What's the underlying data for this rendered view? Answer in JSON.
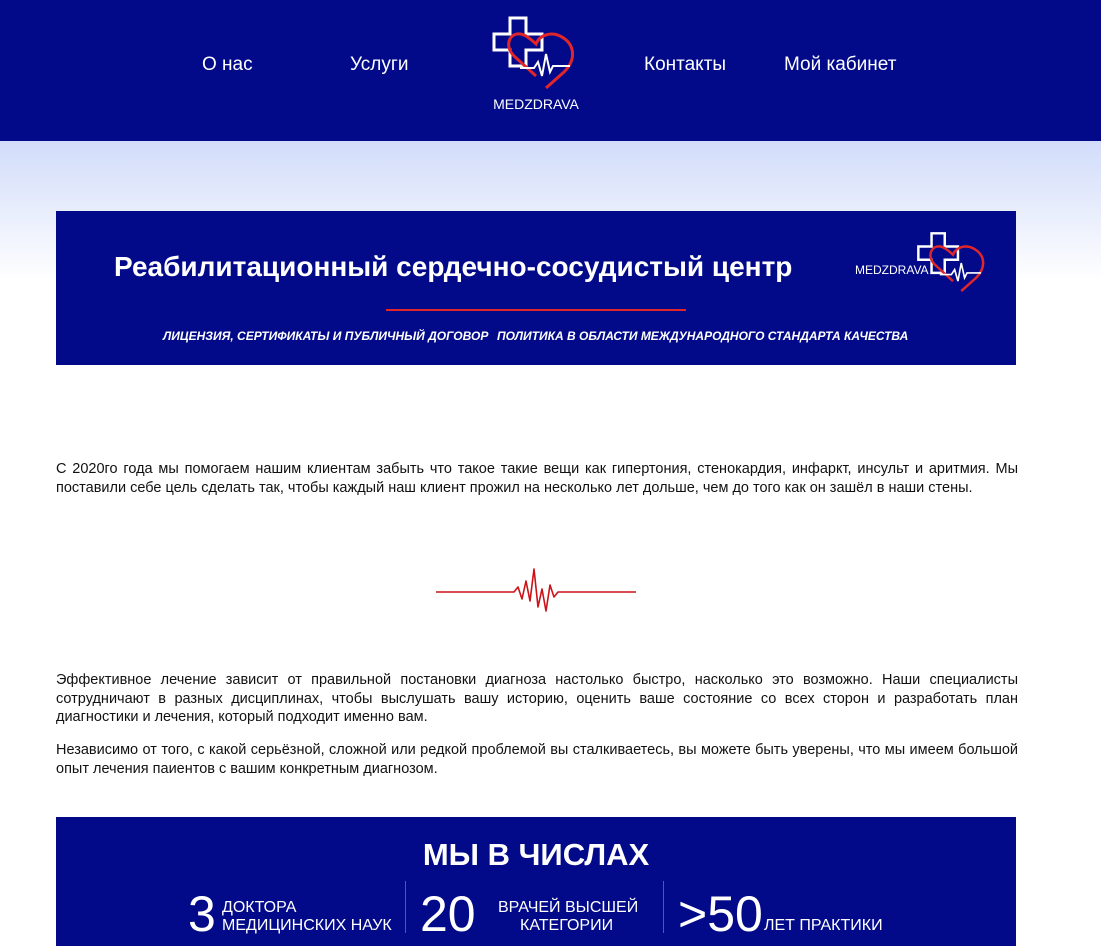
{
  "header": {
    "nav": {
      "about": "О нас",
      "services": "Услуги",
      "contacts": "Контакты",
      "cabinet": "Мой кабинет"
    },
    "logo_text": "MEDZDRAVA"
  },
  "banner": {
    "title": "Реабилитационный сердечно-сосудистый центр",
    "logo_text": "MEDZDRAVA",
    "links": {
      "license": "ЛИЦЕНЗИЯ, СЕРТИФИКАТЫ И ПУБЛИЧНЫЙ ДОГОВОР",
      "policy": "ПОЛИТИКА В ОБЛАСТИ МЕЖДУНАРОДНОГО СТАНДАРТА КАЧЕСТВА"
    }
  },
  "content": {
    "intro": "С 2020го года мы помогаем нашим клиентам забыть что такое такие вещи как гипертония, стенокардия, инфаркт, инсульт и аритмия. Мы поставили себе цель сделать так, чтобы каждый наш клиент прожил на несколько лет дольше, чем до того как он зашёл в наши стены.",
    "treatment": "Эффективное лечение зависит от правильной постановки диагноза настолько быстро, насколько это возможно. Наши специалисты сотрудничают в разных дисциплинах, чтобы выслушать вашу историю, оценить ваше состояние со всех сторон и разработать план диагностики и лечения, который подходит именно вам.",
    "experience": "Независимо от того, с какой серьёзной, сложной или редкой проблемой вы сталкиваетесь, вы можете быть уверены, что мы имеем большой опыт лечения паиентов с вашим конкретным диагнозом."
  },
  "stats": {
    "title": "МЫ В ЧИСЛАХ",
    "items": [
      {
        "number": "3",
        "label_line1": "ДОКТОРА",
        "label_line2": "МЕДИЦИНСКИХ НАУК"
      },
      {
        "number": "20",
        "label_line1": "ВРАЧЕЙ ВЫСШЕЙ",
        "label_line2": "КАТЕГОРИИ"
      },
      {
        "number": ">50",
        "label_line1": "",
        "label_line2": "ЛЕТ ПРАКТИКИ"
      }
    ]
  },
  "colors": {
    "brand_navy": "#020a8a",
    "accent_red": "#e0262b",
    "text": "#111111"
  },
  "icons": [
    "medzdrava-logo-icon",
    "ecg-divider-icon"
  ]
}
